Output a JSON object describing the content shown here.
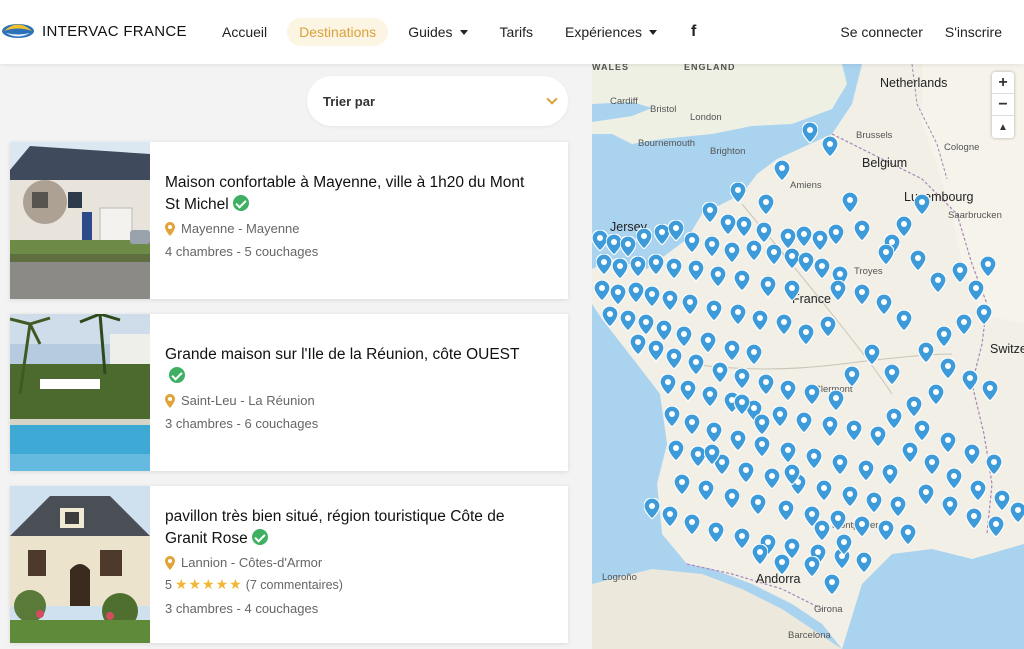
{
  "header": {
    "brand": "INTERVAC FRANCE",
    "nav": [
      {
        "label": "Accueil",
        "caret": false,
        "active": false
      },
      {
        "label": "Destinations",
        "caret": false,
        "active": true
      },
      {
        "label": "Guides",
        "caret": true,
        "active": false
      },
      {
        "label": "Tarifs",
        "caret": false,
        "active": false
      },
      {
        "label": "Expériences",
        "caret": true,
        "active": false
      }
    ],
    "facebook": "f",
    "login": "Se connecter",
    "signup": "S'inscrire"
  },
  "sort": {
    "label": "Trier par"
  },
  "listings": [
    {
      "title": "Maison confortable à Mayenne, ville à 1h20 du Mont St Michel",
      "location": "Mayenne - Mayenne",
      "rating": null,
      "details": "4 chambres - 5 couchages"
    },
    {
      "title": "Grande maison sur l'Ile de la Réunion, côte OUEST",
      "location": "Saint-Leu - La Réunion",
      "rating": null,
      "details": "3 chambres - 6 couchages"
    },
    {
      "title": "pavillon très bien situé, région touristique Côte de Granit Rose",
      "location": "Lannion - Côtes-d'Armor",
      "rating": {
        "score": "5",
        "stars": 5,
        "reviews": "(7 commentaires)"
      },
      "details": "3 chambres - 4 couchages"
    }
  ],
  "map": {
    "controls": {
      "zoom_in": "+",
      "zoom_out": "−",
      "reset": "▲"
    },
    "labels": [
      {
        "text": "WALES",
        "kind": "caps"
      },
      {
        "text": "ENGLAND",
        "kind": "caps"
      },
      {
        "text": "Netherlands",
        "kind": "country"
      },
      {
        "text": "Cardiff",
        "kind": "small"
      },
      {
        "text": "Bristol",
        "kind": "small"
      },
      {
        "text": "London",
        "kind": "small"
      },
      {
        "text": "Bournemouth",
        "kind": "small"
      },
      {
        "text": "Brighton",
        "kind": "small"
      },
      {
        "text": "Brussels",
        "kind": "small"
      },
      {
        "text": "Belgium",
        "kind": "country"
      },
      {
        "text": "Cologne",
        "kind": "small"
      },
      {
        "text": "Amiens",
        "kind": "small"
      },
      {
        "text": "Luxembourg",
        "kind": "country"
      },
      {
        "text": "Saarbrucken",
        "kind": "small"
      },
      {
        "text": "Jersey",
        "kind": "country"
      },
      {
        "text": "France",
        "kind": "country"
      },
      {
        "text": "Troyes",
        "kind": "small"
      },
      {
        "text": "Switze",
        "kind": "country"
      },
      {
        "text": "Clermont",
        "kind": "small"
      },
      {
        "text": "Montpellier",
        "kind": "small"
      },
      {
        "text": "Andorra",
        "kind": "country"
      },
      {
        "text": "Girona",
        "kind": "small"
      },
      {
        "text": "Barcelona",
        "kind": "small"
      },
      {
        "text": "Logroño",
        "kind": "small"
      }
    ],
    "marker_color": "#3d9bd9"
  }
}
